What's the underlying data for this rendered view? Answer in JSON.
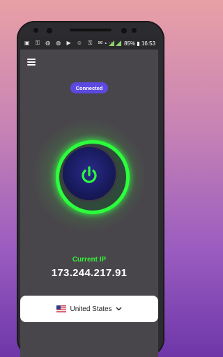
{
  "status_bar": {
    "battery": "85%",
    "time": "16:53",
    "left_icons": [
      "image-icon",
      "key-icon",
      "whatsapp-icon",
      "whatsapp-icon",
      "play-icon",
      "user-icon",
      "vpn-icon",
      "mail-icon",
      "more-icon"
    ],
    "right_icons": [
      "wifi-icon",
      "signal-icon",
      "signal-icon",
      "battery-icon"
    ]
  },
  "connection": {
    "status_label": "Connected"
  },
  "ip": {
    "label": "Current IP",
    "value": "173.244.217.91"
  },
  "country": {
    "name": "United States",
    "flag": "us-flag-icon"
  },
  "colors": {
    "accent_green": "#2cff3c",
    "pill_purple": "#5b49e0",
    "screen_bg": "#49464b",
    "core_blue": "#1a1d64"
  }
}
